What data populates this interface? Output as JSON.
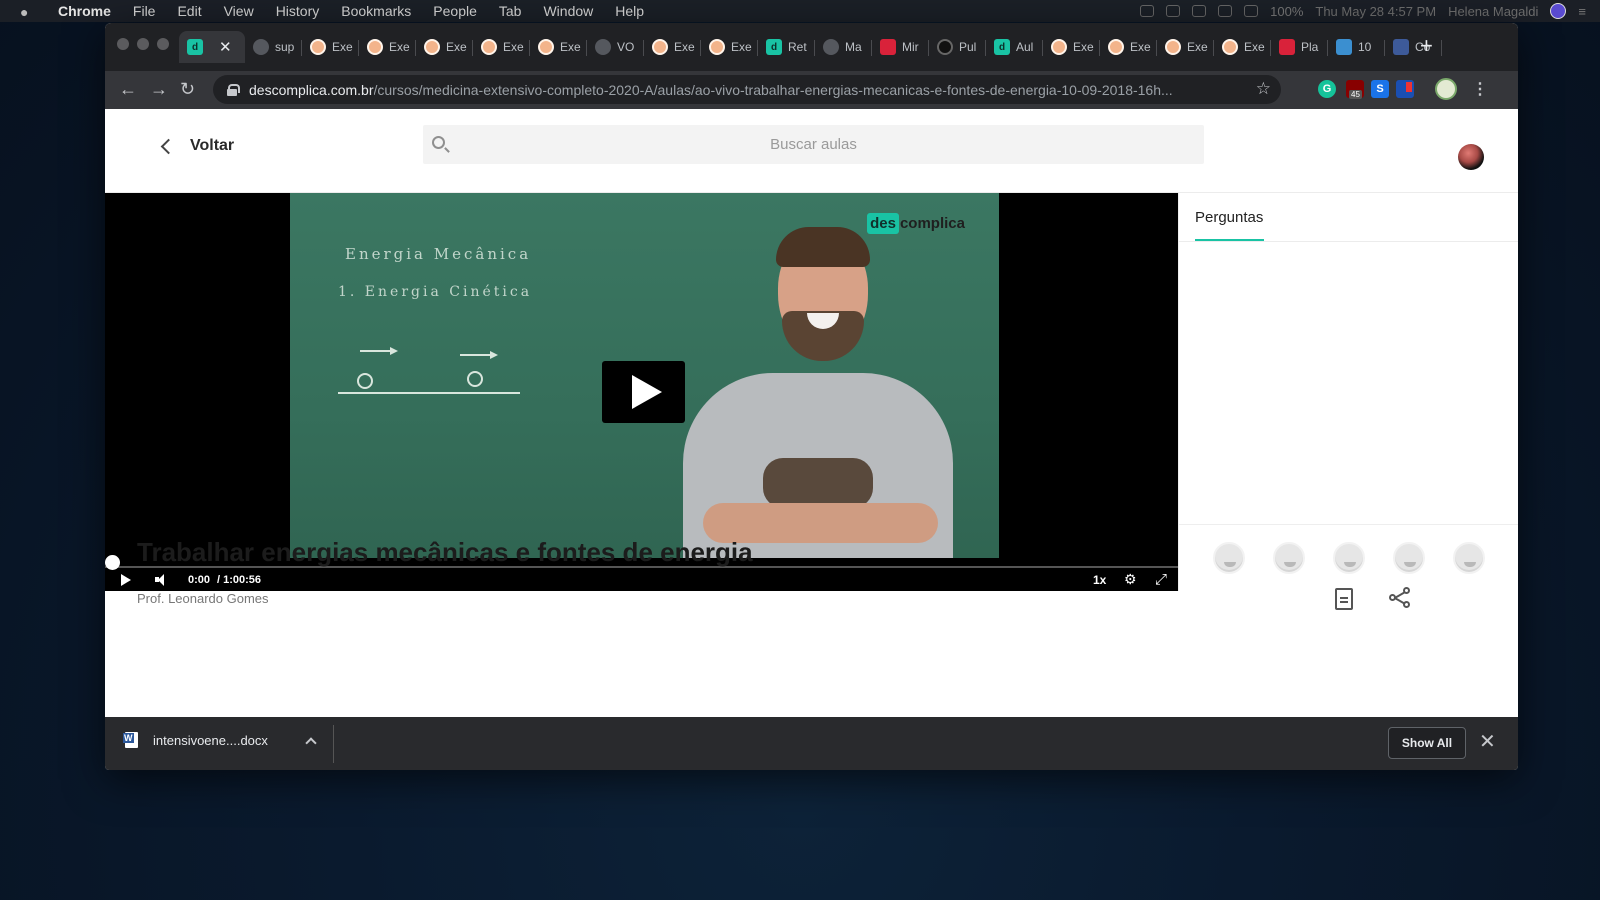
{
  "menubar": {
    "app": "Chrome",
    "items": [
      "File",
      "Edit",
      "View",
      "History",
      "Bookmarks",
      "People",
      "Tab",
      "Window",
      "Help"
    ],
    "clock": "Thu May 28  4:57 PM",
    "user": "Helena Magaldi",
    "battery": "100%"
  },
  "tabs": [
    {
      "label": "",
      "icon": "descomplica-icon",
      "active": true
    },
    {
      "label": "sup",
      "icon": "globe-icon"
    },
    {
      "label": "Exe",
      "icon": "face-icon"
    },
    {
      "label": "Exe",
      "icon": "face-icon"
    },
    {
      "label": "Exe",
      "icon": "face-icon"
    },
    {
      "label": "Exe",
      "icon": "face-icon"
    },
    {
      "label": "Exe",
      "icon": "face-icon"
    },
    {
      "label": "VO",
      "icon": "globe-icon"
    },
    {
      "label": "Exe",
      "icon": "face-icon"
    },
    {
      "label": "Exe",
      "icon": "face-icon"
    },
    {
      "label": "Ret",
      "icon": "descomplica-icon"
    },
    {
      "label": "Ma",
      "icon": "globe-icon"
    },
    {
      "label": "Mir",
      "icon": "lips-icon"
    },
    {
      "label": "Pul",
      "icon": "circle-icon"
    },
    {
      "label": "Aul",
      "icon": "descomplica-icon"
    },
    {
      "label": "Exe",
      "icon": "face-icon"
    },
    {
      "label": "Exe",
      "icon": "face-icon"
    },
    {
      "label": "Exe",
      "icon": "face-icon"
    },
    {
      "label": "Exe",
      "icon": "face-icon"
    },
    {
      "label": "Pla",
      "icon": "lips-icon"
    },
    {
      "label": "10",
      "icon": "cup-icon"
    },
    {
      "label": "Co",
      "icon": "wave-icon"
    }
  ],
  "omnibox": {
    "host": "descomplica.com.br",
    "path": "/cursos/medicina-extensivo-completo-2020-A/aulas/ao-vivo-trabalhar-energias-mecanicas-e-fontes-de-energia-10-09-2018-16h..."
  },
  "extensions": {
    "ublock_badge": "45",
    "grammarly": "G",
    "s_ext": "S"
  },
  "page": {
    "back_label": "Voltar",
    "search_placeholder": "Buscar aulas"
  },
  "video": {
    "logo": "descomplica",
    "logo_des": "des",
    "logo_rest": "complica",
    "chalk_line1": "Energia Mecânica",
    "chalk_line2": "1. Energia Cinética",
    "current_time": "0:00",
    "duration": "/ 1:00:56",
    "speed": "1x",
    "progress": 0.0
  },
  "sidebar": {
    "tab_label": "Perguntas",
    "reactions": [
      "bored-icon",
      "surprised-icon",
      "skeptical-icon",
      "laughing-icon",
      "robot-icon"
    ]
  },
  "lesson": {
    "title": "Trabalhar energias mecânicas e fontes de energia",
    "teacher": "Prof. Leonardo Gomes"
  },
  "downloads": {
    "file_name": "intensivoene....docx",
    "show_all": "Show All"
  }
}
